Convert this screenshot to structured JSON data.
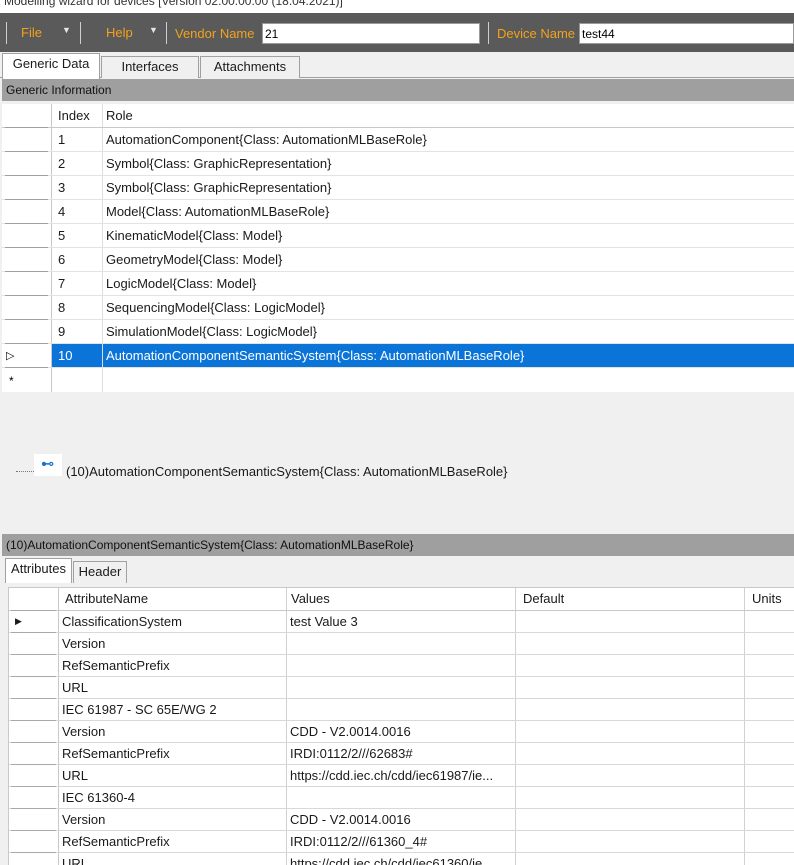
{
  "window": {
    "title": "Modelling wizard for devices [Version 02.00.00.00 (18.04.2021)]"
  },
  "menubar": {
    "file_label": "File",
    "help_label": "Help",
    "vendor_label": "Vendor Name",
    "vendor_value": "21",
    "device_label": "Device Name",
    "device_value": "test44"
  },
  "tabs": [
    "Generic Data",
    "Interfaces",
    "Attachments"
  ],
  "generic_info": {
    "header": "Generic Information",
    "columns": {
      "index": "Index",
      "role": "Role"
    },
    "rows": [
      {
        "index": "1",
        "role": "AutomationComponent{Class:  AutomationMLBaseRole}"
      },
      {
        "index": "2",
        "role": "Symbol{Class:  GraphicRepresentation}"
      },
      {
        "index": "3",
        "role": "Symbol{Class:  GraphicRepresentation}"
      },
      {
        "index": "4",
        "role": "Model{Class:  AutomationMLBaseRole}"
      },
      {
        "index": "5",
        "role": "KinematicModel{Class:  Model}"
      },
      {
        "index": "6",
        "role": "GeometryModel{Class:  Model}"
      },
      {
        "index": "7",
        "role": "LogicModel{Class:  Model}"
      },
      {
        "index": "8",
        "role": "SequencingModel{Class:  LogicModel}"
      },
      {
        "index": "9",
        "role": "SimulationModel{Class:  LogicModel}"
      },
      {
        "index": "10",
        "role": "AutomationComponentSemanticSystem{Class:  AutomationMLBaseRole}"
      }
    ],
    "selected_row": 10,
    "new_row_marker": "*"
  },
  "tree": {
    "node_label": "(10)AutomationComponentSemanticSystem{Class:  AutomationMLBaseRole}"
  },
  "detail": {
    "header": "(10)AutomationComponentSemanticSystem{Class:  AutomationMLBaseRole}",
    "tabs": [
      "Attributes",
      "Header"
    ],
    "columns": {
      "name": "AttributeName",
      "values": "Values",
      "default": "Default",
      "units": "Units"
    },
    "rows": [
      {
        "name": "ClassificationSystem",
        "value": "test Value 3"
      },
      {
        "name": "Version",
        "value": ""
      },
      {
        "name": "RefSemanticPrefix",
        "value": ""
      },
      {
        "name": "URL",
        "value": ""
      },
      {
        "name": "IEC 61987 - SC 65E/WG 2",
        "value": ""
      },
      {
        "name": "Version",
        "value": "CDD - V2.0014.0016"
      },
      {
        "name": "RefSemanticPrefix",
        "value": "IRDI:0112/2///62683#"
      },
      {
        "name": "URL",
        "value": "https://cdd.iec.ch/cdd/iec61987/ie..."
      },
      {
        "name": "IEC 61360-4",
        "value": ""
      },
      {
        "name": "Version",
        "value": "CDD - V2.0014.0016"
      },
      {
        "name": "RefSemanticPrefix",
        "value": "IRDI:0112/2///61360_4#"
      },
      {
        "name": "URL",
        "value": "https://cdd.iec.ch/cdd/iec61360/ie..."
      }
    ]
  },
  "icons": {
    "menu_dropdown": "chevron-down-icon",
    "row_pointer": "row-pointer-icon",
    "tree_node": "interface-node-icon"
  },
  "colors": {
    "menubar_bg": "#5a5a5a",
    "menu_accent": "#f3a21b",
    "selection": "#0a74d8",
    "section_header_bg": "#9f9f9f"
  }
}
